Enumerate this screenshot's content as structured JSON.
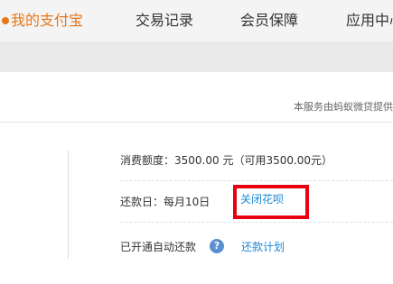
{
  "nav": {
    "tabs": [
      {
        "label": "我的支付宝",
        "active": true
      },
      {
        "label": "交易记录"
      },
      {
        "label": "会员保障"
      },
      {
        "label": "应用中心"
      }
    ]
  },
  "notice": {
    "text": "本服务由蚂蚁微贷提供"
  },
  "details": {
    "credit_line": "消费额度：3500.00 元（可用3500.00元）",
    "repay_day": "还款日：每月10日",
    "close_link": "关闭花呗",
    "auto_repay": "已开通自动还款",
    "help_icon_glyph": "?",
    "plan_link": "还款计划"
  },
  "colors": {
    "accent": "#e7771b",
    "link": "#1a88d8",
    "highlight": "#e60012"
  },
  "icons": [
    "help-circle-icon"
  ]
}
